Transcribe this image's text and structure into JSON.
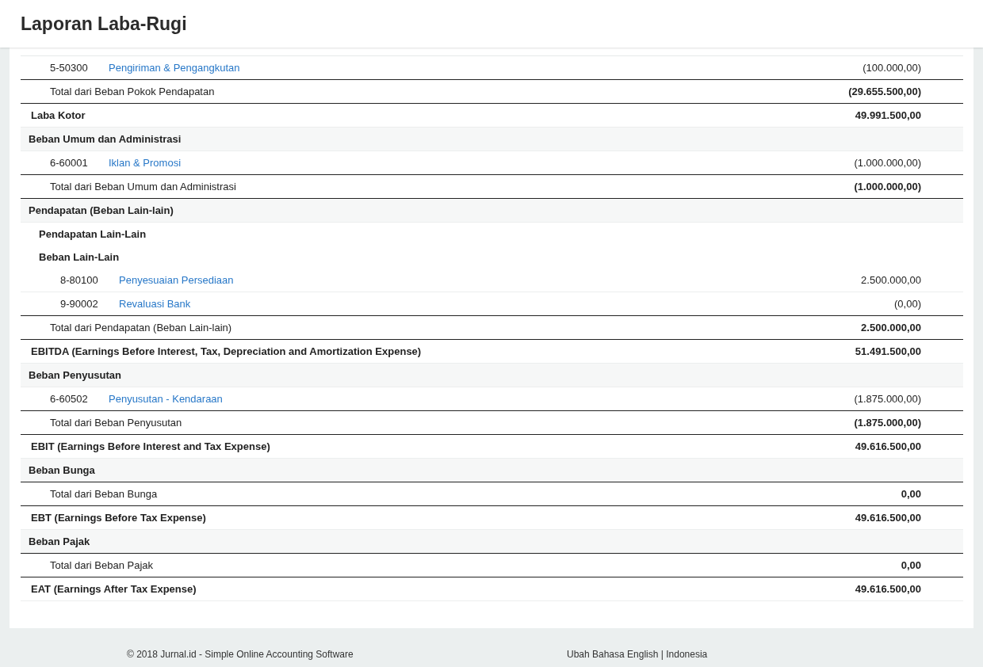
{
  "title": "Laporan Laba-Rugi",
  "rows": [
    {
      "kind": "group",
      "children": [
        {
          "kind": "account",
          "code": "5-50300",
          "name": "Pengiriman & Pengangkutan",
          "amount": "(100.000,00)"
        },
        {
          "kind": "total",
          "label": "Total dari Beban Pokok Pendapatan",
          "amount": "(29.655.500,00)"
        }
      ]
    },
    {
      "kind": "summary",
      "label": "Laba Kotor",
      "amount": "49.991.500,00"
    },
    {
      "kind": "group",
      "label": "Beban Umum dan Administrasi",
      "children": [
        {
          "kind": "account",
          "code": "6-60001",
          "name": "Iklan & Promosi",
          "amount": "(1.000.000,00)"
        },
        {
          "kind": "total",
          "label": "Total dari Beban Umum dan Administrasi",
          "amount": "(1.000.000,00)"
        }
      ]
    },
    {
      "kind": "group",
      "label": "Pendapatan (Beban Lain-lain)",
      "children": [
        {
          "kind": "group",
          "label": "Pendapatan Lain-Lain"
        },
        {
          "kind": "group",
          "label": "Beban Lain-Lain",
          "children": [
            {
              "kind": "account",
              "code": "8-80100",
              "name": "Penyesuaian Persediaan",
              "amount": "2.500.000,00"
            },
            {
              "kind": "account",
              "code": "9-90002",
              "name": "Revaluasi Bank",
              "amount": "(0,00)"
            }
          ]
        },
        {
          "kind": "total",
          "label": "Total dari Pendapatan (Beban Lain-lain)",
          "amount": "2.500.000,00"
        }
      ]
    },
    {
      "kind": "summary",
      "label": "EBITDA (Earnings Before Interest, Tax, Depreciation and Amortization Expense)",
      "amount": "51.491.500,00"
    },
    {
      "kind": "group",
      "label": "Beban Penyusutan",
      "children": [
        {
          "kind": "account",
          "code": "6-60502",
          "name": "Penyusutan - Kendaraan",
          "amount": "(1.875.000,00)"
        },
        {
          "kind": "total",
          "label": "Total dari Beban Penyusutan",
          "amount": "(1.875.000,00)"
        }
      ]
    },
    {
      "kind": "summary",
      "label": "EBIT (Earnings Before Interest and Tax Expense)",
      "amount": "49.616.500,00"
    },
    {
      "kind": "group",
      "label": "Beban Bunga",
      "children": [
        {
          "kind": "total",
          "label": "Total dari Beban Bunga",
          "amount": "0,00"
        }
      ]
    },
    {
      "kind": "summary",
      "label": "EBT (Earnings Before Tax Expense)",
      "amount": "49.616.500,00"
    },
    {
      "kind": "group",
      "label": "Beban Pajak",
      "children": [
        {
          "kind": "total",
          "label": "Total dari Beban Pajak",
          "amount": "0,00"
        }
      ]
    },
    {
      "kind": "summary",
      "label": "EAT (Earnings After Tax Expense)",
      "amount": "49.616.500,00"
    }
  ],
  "footer": {
    "copyright": "© 2018 Jurnal.id - Simple Online Accounting Software",
    "language_label": "Ubah Bahasa",
    "languages": [
      "English",
      "Indonesia"
    ],
    "separator": "|"
  }
}
